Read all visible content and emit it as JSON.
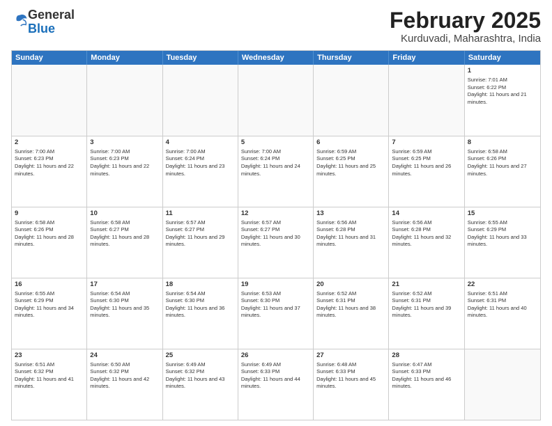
{
  "header": {
    "logo": {
      "line1": "General",
      "line2": "Blue"
    },
    "title": "February 2025",
    "location": "Kurduvadi, Maharashtra, India"
  },
  "weekdays": [
    "Sunday",
    "Monday",
    "Tuesday",
    "Wednesday",
    "Thursday",
    "Friday",
    "Saturday"
  ],
  "weeks": [
    [
      {
        "day": "",
        "info": ""
      },
      {
        "day": "",
        "info": ""
      },
      {
        "day": "",
        "info": ""
      },
      {
        "day": "",
        "info": ""
      },
      {
        "day": "",
        "info": ""
      },
      {
        "day": "",
        "info": ""
      },
      {
        "day": "1",
        "info": "Sunrise: 7:01 AM\nSunset: 6:22 PM\nDaylight: 11 hours and 21 minutes."
      }
    ],
    [
      {
        "day": "2",
        "info": "Sunrise: 7:00 AM\nSunset: 6:23 PM\nDaylight: 11 hours and 22 minutes."
      },
      {
        "day": "3",
        "info": "Sunrise: 7:00 AM\nSunset: 6:23 PM\nDaylight: 11 hours and 22 minutes."
      },
      {
        "day": "4",
        "info": "Sunrise: 7:00 AM\nSunset: 6:24 PM\nDaylight: 11 hours and 23 minutes."
      },
      {
        "day": "5",
        "info": "Sunrise: 7:00 AM\nSunset: 6:24 PM\nDaylight: 11 hours and 24 minutes."
      },
      {
        "day": "6",
        "info": "Sunrise: 6:59 AM\nSunset: 6:25 PM\nDaylight: 11 hours and 25 minutes."
      },
      {
        "day": "7",
        "info": "Sunrise: 6:59 AM\nSunset: 6:25 PM\nDaylight: 11 hours and 26 minutes."
      },
      {
        "day": "8",
        "info": "Sunrise: 6:58 AM\nSunset: 6:26 PM\nDaylight: 11 hours and 27 minutes."
      }
    ],
    [
      {
        "day": "9",
        "info": "Sunrise: 6:58 AM\nSunset: 6:26 PM\nDaylight: 11 hours and 28 minutes."
      },
      {
        "day": "10",
        "info": "Sunrise: 6:58 AM\nSunset: 6:27 PM\nDaylight: 11 hours and 28 minutes."
      },
      {
        "day": "11",
        "info": "Sunrise: 6:57 AM\nSunset: 6:27 PM\nDaylight: 11 hours and 29 minutes."
      },
      {
        "day": "12",
        "info": "Sunrise: 6:57 AM\nSunset: 6:27 PM\nDaylight: 11 hours and 30 minutes."
      },
      {
        "day": "13",
        "info": "Sunrise: 6:56 AM\nSunset: 6:28 PM\nDaylight: 11 hours and 31 minutes."
      },
      {
        "day": "14",
        "info": "Sunrise: 6:56 AM\nSunset: 6:28 PM\nDaylight: 11 hours and 32 minutes."
      },
      {
        "day": "15",
        "info": "Sunrise: 6:55 AM\nSunset: 6:29 PM\nDaylight: 11 hours and 33 minutes."
      }
    ],
    [
      {
        "day": "16",
        "info": "Sunrise: 6:55 AM\nSunset: 6:29 PM\nDaylight: 11 hours and 34 minutes."
      },
      {
        "day": "17",
        "info": "Sunrise: 6:54 AM\nSunset: 6:30 PM\nDaylight: 11 hours and 35 minutes."
      },
      {
        "day": "18",
        "info": "Sunrise: 6:54 AM\nSunset: 6:30 PM\nDaylight: 11 hours and 36 minutes."
      },
      {
        "day": "19",
        "info": "Sunrise: 6:53 AM\nSunset: 6:30 PM\nDaylight: 11 hours and 37 minutes."
      },
      {
        "day": "20",
        "info": "Sunrise: 6:52 AM\nSunset: 6:31 PM\nDaylight: 11 hours and 38 minutes."
      },
      {
        "day": "21",
        "info": "Sunrise: 6:52 AM\nSunset: 6:31 PM\nDaylight: 11 hours and 39 minutes."
      },
      {
        "day": "22",
        "info": "Sunrise: 6:51 AM\nSunset: 6:31 PM\nDaylight: 11 hours and 40 minutes."
      }
    ],
    [
      {
        "day": "23",
        "info": "Sunrise: 6:51 AM\nSunset: 6:32 PM\nDaylight: 11 hours and 41 minutes."
      },
      {
        "day": "24",
        "info": "Sunrise: 6:50 AM\nSunset: 6:32 PM\nDaylight: 11 hours and 42 minutes."
      },
      {
        "day": "25",
        "info": "Sunrise: 6:49 AM\nSunset: 6:32 PM\nDaylight: 11 hours and 43 minutes."
      },
      {
        "day": "26",
        "info": "Sunrise: 6:49 AM\nSunset: 6:33 PM\nDaylight: 11 hours and 44 minutes."
      },
      {
        "day": "27",
        "info": "Sunrise: 6:48 AM\nSunset: 6:33 PM\nDaylight: 11 hours and 45 minutes."
      },
      {
        "day": "28",
        "info": "Sunrise: 6:47 AM\nSunset: 6:33 PM\nDaylight: 11 hours and 46 minutes."
      },
      {
        "day": "",
        "info": ""
      }
    ]
  ]
}
